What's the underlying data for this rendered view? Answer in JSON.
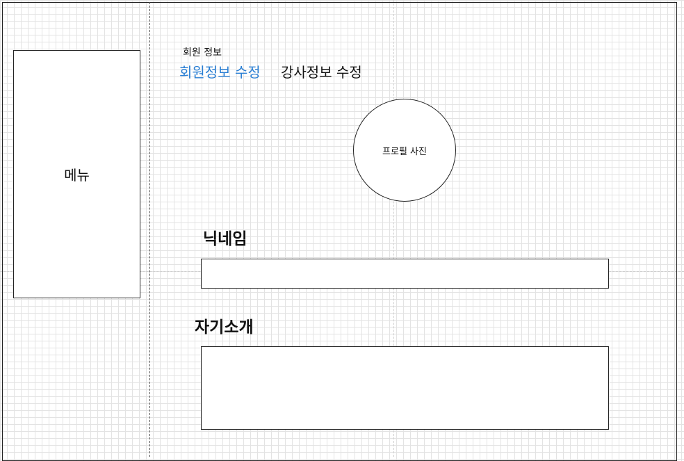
{
  "menu": {
    "label": "메뉴"
  },
  "breadcrumb": {
    "label": "회원 정보"
  },
  "tabs": [
    {
      "label": "회원정보 수정",
      "active": true,
      "color": "#2a7fd4"
    },
    {
      "label": "강사정보 수정",
      "active": false,
      "color": "#111111"
    }
  ],
  "profile": {
    "photo_label": "프로필 사진"
  },
  "nickname": {
    "label": "닉네임",
    "value": "",
    "placeholder": ""
  },
  "intro": {
    "label": "자기소개",
    "value": "",
    "placeholder": ""
  }
}
